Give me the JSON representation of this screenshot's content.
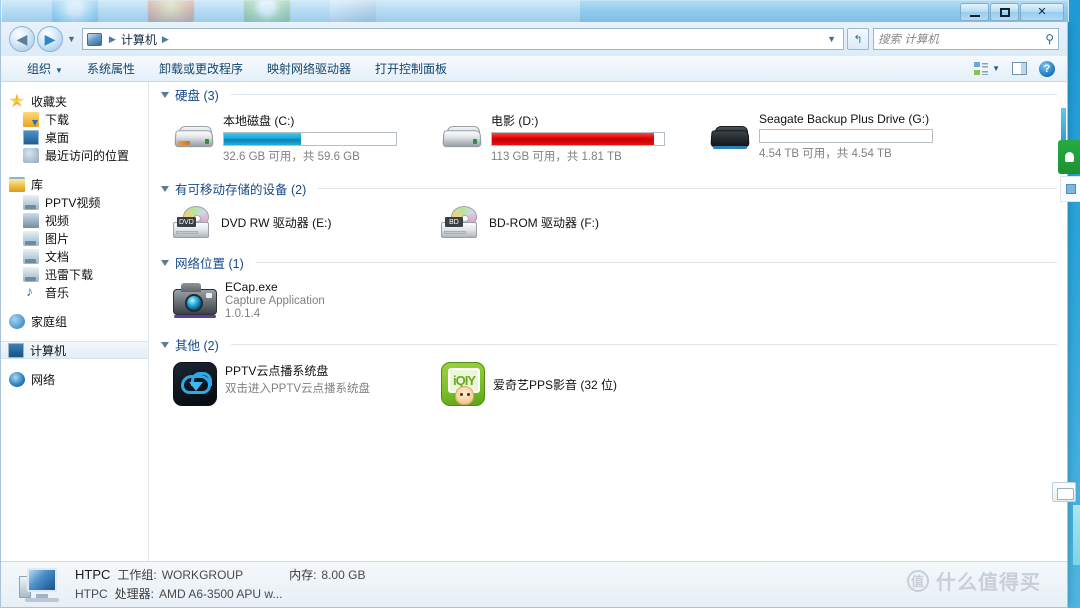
{
  "window": {
    "title": "计算机",
    "controls": {
      "minimize": "–",
      "maximize": "□",
      "close": "✕"
    }
  },
  "address_bar": {
    "back_label": "◀",
    "forward_label": "▶",
    "history_caret": "▼",
    "breadcrumb": {
      "root_icon": "computer-icon",
      "sep": "▶",
      "path": "计算机",
      "tail_sep": "▶"
    },
    "path_dropdown": "▼",
    "refresh_label": "↰",
    "search": {
      "placeholder": "搜索 计算机",
      "icon": "search-icon"
    }
  },
  "toolbar": {
    "items": [
      {
        "label": "组织",
        "has_caret": true
      },
      {
        "label": "系统属性",
        "has_caret": false
      },
      {
        "label": "卸载或更改程序",
        "has_caret": false
      },
      {
        "label": "映射网络驱动器",
        "has_caret": false
      },
      {
        "label": "打开控制面板",
        "has_caret": false
      }
    ],
    "caret": "▼",
    "view_button": "change-view",
    "preview_pane_button": "preview-pane",
    "help_button": "?"
  },
  "sidebar": {
    "groups": [
      {
        "root": {
          "label": "收藏夹",
          "icon": "star-icon"
        },
        "children": [
          {
            "label": "下载",
            "icon": "download-icon"
          },
          {
            "label": "桌面",
            "icon": "desktop-icon"
          },
          {
            "label": "最近访问的位置",
            "icon": "recent-places-icon"
          }
        ]
      },
      {
        "root": {
          "label": "库",
          "icon": "library-icon"
        },
        "children": [
          {
            "label": "PPTV视频",
            "icon": "library-folder-icon"
          },
          {
            "label": "视频",
            "icon": "video-library-icon"
          },
          {
            "label": "图片",
            "icon": "pictures-library-icon"
          },
          {
            "label": "文档",
            "icon": "documents-library-icon"
          },
          {
            "label": "迅雷下载",
            "icon": "library-folder-icon"
          },
          {
            "label": "音乐",
            "icon": "music-note-icon"
          }
        ]
      },
      {
        "root": {
          "label": "家庭组",
          "icon": "homegroup-icon"
        },
        "children": []
      },
      {
        "root": {
          "label": "计算机",
          "icon": "computer-icon",
          "selected": true
        },
        "children": []
      },
      {
        "root": {
          "label": "网络",
          "icon": "network-icon"
        },
        "children": []
      }
    ]
  },
  "sections": [
    {
      "title": "硬盘 (3)",
      "kind": "drives",
      "items": [
        {
          "name": "本地磁盘 (C:)",
          "capacity_text": "32.6 GB 可用，共 59.6 GB",
          "free": "32.6 GB",
          "total": "59.6 GB",
          "used_percent": 45,
          "bar_color": "#0d7fb4",
          "bar_state": "blue",
          "icon": "hard-drive-icon"
        },
        {
          "name": "电影 (D:)",
          "capacity_text": "113 GB 可用，共 1.81 TB",
          "free": "113 GB",
          "total": "1.81 TB",
          "used_percent": 94,
          "bar_color": "#c40000",
          "bar_state": "red",
          "icon": "hard-drive-icon"
        },
        {
          "name": "Seagate Backup Plus Drive (G:)",
          "capacity_text": "4.54 TB 可用，共 4.54 TB",
          "free": "4.54 TB",
          "total": "4.54 TB",
          "used_percent": 0,
          "bar_color": "#ffffff",
          "bar_state": "empty",
          "icon": "external-drive-icon"
        }
      ]
    },
    {
      "title": "有可移动存储的设备 (2)",
      "kind": "removable",
      "items": [
        {
          "name": "DVD RW 驱动器 (E:)",
          "badge": "DVD",
          "icon": "dvd-drive-icon"
        },
        {
          "name": "BD-ROM 驱动器 (F:)",
          "badge": "BD",
          "icon": "bd-drive-icon"
        }
      ]
    },
    {
      "title": "网络位置 (1)",
      "kind": "network",
      "items": [
        {
          "name": "ECap.exe",
          "line2": "Capture Application",
          "line3": "1.0.1.4",
          "icon": "camera-icon"
        }
      ]
    },
    {
      "title": "其他 (2)",
      "kind": "other",
      "items": [
        {
          "name": "PPTV云点播系统盘",
          "line2": "双击进入PPTV云点播系统盘",
          "icon": "pptv-cloud-icon"
        },
        {
          "name": "爱奇艺PPS影音 (32 位)",
          "line2": "",
          "icon": "iqiyi-icon"
        }
      ]
    }
  ],
  "status_bar": {
    "computer_name": "HTPC",
    "workgroup_label": "工作组:",
    "workgroup_value": "WORKGROUP",
    "memory_label": "内存:",
    "memory_value": "8.00 GB",
    "second_name": "HTPC",
    "processor_label": "处理器:",
    "processor_value": "AMD A6-3500 APU w..."
  },
  "watermark": {
    "badge": "值",
    "text": "什么值得买"
  }
}
